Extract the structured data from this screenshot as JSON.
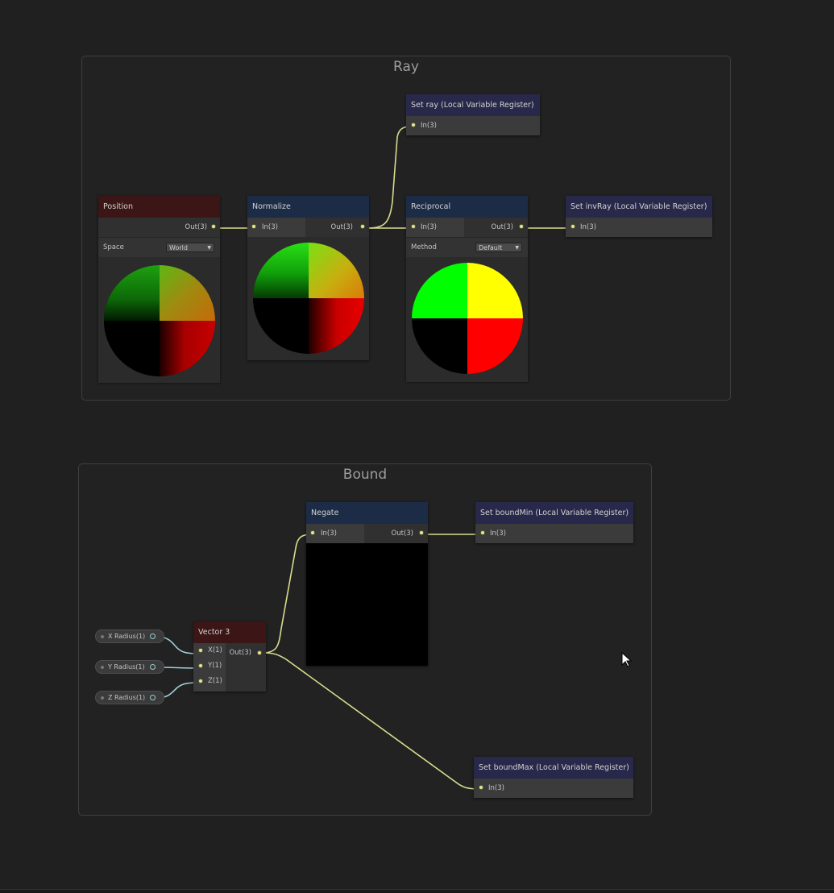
{
  "groups": {
    "ray": {
      "title": "Ray"
    },
    "bound": {
      "title": "Bound"
    }
  },
  "nodes": {
    "position": {
      "title": "Position",
      "out": "Out(3)",
      "prop_label": "Space",
      "prop_value": "World"
    },
    "normalize": {
      "title": "Normalize",
      "in": "In(3)",
      "out": "Out(3)"
    },
    "set_ray": {
      "title": "Set ray (Local Variable Register)",
      "in": "In(3)"
    },
    "reciprocal": {
      "title": "Reciprocal",
      "in": "In(3)",
      "out": "Out(3)",
      "prop_label": "Method",
      "prop_value": "Default"
    },
    "set_invray": {
      "title": "Set invRay (Local Variable Register)",
      "in": "In(3)"
    },
    "negate": {
      "title": "Negate",
      "in": "In(3)",
      "out": "Out(3)"
    },
    "set_boundmin": {
      "title": "Set boundMin (Local Variable Register)",
      "in": "In(3)"
    },
    "vector3": {
      "title": "Vector 3",
      "in_x": "X(1)",
      "in_y": "Y(1)",
      "in_z": "Z(1)",
      "out": "Out(3)"
    },
    "set_boundmax": {
      "title": "Set boundMax (Local Variable Register)",
      "in": "In(3)"
    }
  },
  "properties": {
    "x_radius": "X Radius(1)",
    "y_radius": "Y Radius(1)",
    "z_radius": "Z Radius(1)"
  },
  "colors": {
    "background": "#202020",
    "wire_vec3": "#d8dc8c",
    "wire_float": "#9fd0dc",
    "header_red": "#3c1616",
    "header_blue": "#1c2c47",
    "header_purple": "#28284a"
  }
}
